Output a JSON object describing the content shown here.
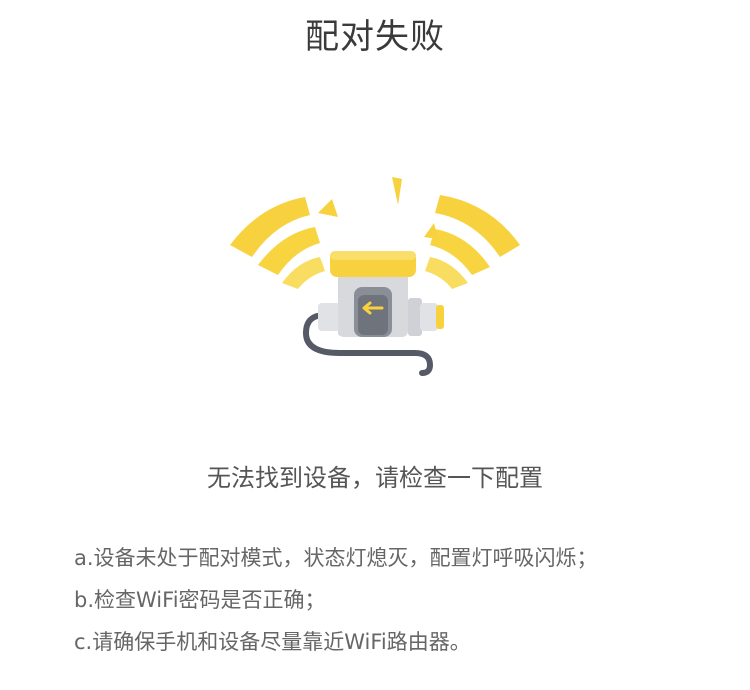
{
  "header": {
    "title": "配对失败"
  },
  "illustration": {
    "icon": "device-signal-icon",
    "accent_color": "#F7D23E",
    "device_color": "#D8D9DD",
    "cable_color": "#555A66"
  },
  "main": {
    "message": "无法找到设备，请检查一下配置",
    "tips": [
      "a.设备未处于配对模式，状态灯熄灭，配置灯呼吸闪烁；",
      "b.检查WiFi密码是否正确；",
      "c.请确保手机和设备尽量靠近WiFi路由器。"
    ]
  }
}
